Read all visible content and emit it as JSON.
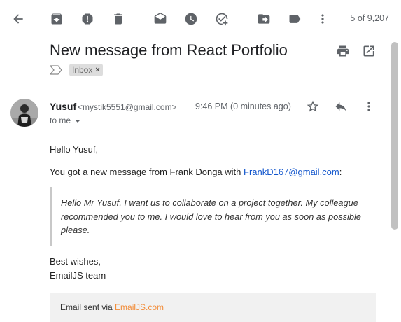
{
  "toolbar": {
    "page_count": "5 of 9,207",
    "icons": [
      "back-arrow-icon",
      "archive-icon",
      "report-spam-icon",
      "delete-icon",
      "mark-unread-icon",
      "snooze-icon",
      "add-task-icon",
      "move-to-icon",
      "label-icon",
      "more-vert-icon"
    ]
  },
  "message": {
    "subject": "New message from React Portfolio",
    "label": "Inbox",
    "label_remove": "×",
    "sender_name": "Yusuf",
    "sender_email": "<mystik5551@gmail.com>",
    "time": "9:46 PM (0 minutes ago)",
    "recipient": "to me",
    "greeting": "Hello Yusuf,",
    "intro_prefix": "You got a new message from Frank Donga with ",
    "intro_link": "FrankD167@gmail.com",
    "intro_suffix": ":",
    "quote": "Hello Mr Yusuf, I want us to collaborate on a project together. My colleague recommended you to me. I would love to hear from you as soon as possible please.",
    "signoff_line1": "Best wishes,",
    "signoff_line2": "EmailJS team",
    "footer_prefix": "Email sent via ",
    "footer_link": "EmailJS.com"
  },
  "colors": {
    "link": "#1155cc",
    "footer_link": "#f28c38",
    "icon": "#5f6368"
  }
}
